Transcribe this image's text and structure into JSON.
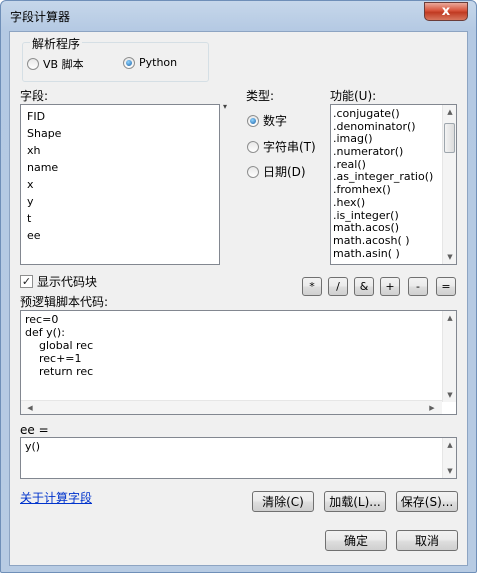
{
  "window": {
    "title": "字段计算器",
    "close_glyph": "x"
  },
  "parser": {
    "label": "解析程序",
    "options": [
      {
        "label": "VB 脚本",
        "selected": false
      },
      {
        "label": "Python",
        "selected": true
      }
    ]
  },
  "fields": {
    "label": "字段:",
    "items": [
      "FID",
      "Shape",
      "xh",
      "name",
      "x",
      "y",
      "t",
      "ee"
    ]
  },
  "type": {
    "label": "类型:",
    "options": [
      {
        "label": "数字",
        "selected": true
      },
      {
        "label": "字符串(T)",
        "selected": false
      },
      {
        "label": "日期(D)",
        "selected": false
      }
    ]
  },
  "functions": {
    "label": "功能(U):",
    "items": [
      ".conjugate()",
      ".denominator()",
      ".imag()",
      ".numerator()",
      ".real()",
      ".as_integer_ratio()",
      ".fromhex()",
      ".hex()",
      ".is_integer()",
      "math.acos()",
      "math.acosh( )",
      "math.asin( )"
    ]
  },
  "operators": [
    "*",
    "/",
    "&",
    "+",
    "-",
    "="
  ],
  "show_codeblock": {
    "label": "显示代码块",
    "checked": true
  },
  "prelogic": {
    "label": "预逻辑脚本代码:",
    "code": "rec=0\ndef y():\n    global rec\n    rec+=1\n    return rec"
  },
  "expression": {
    "label": "ee =",
    "code": "y()"
  },
  "about_link": "关于计算字段",
  "buttons": {
    "clear": "清除(C)",
    "load": "加载(L)...",
    "save": "保存(S)...",
    "ok": "确定",
    "cancel": "取消"
  }
}
